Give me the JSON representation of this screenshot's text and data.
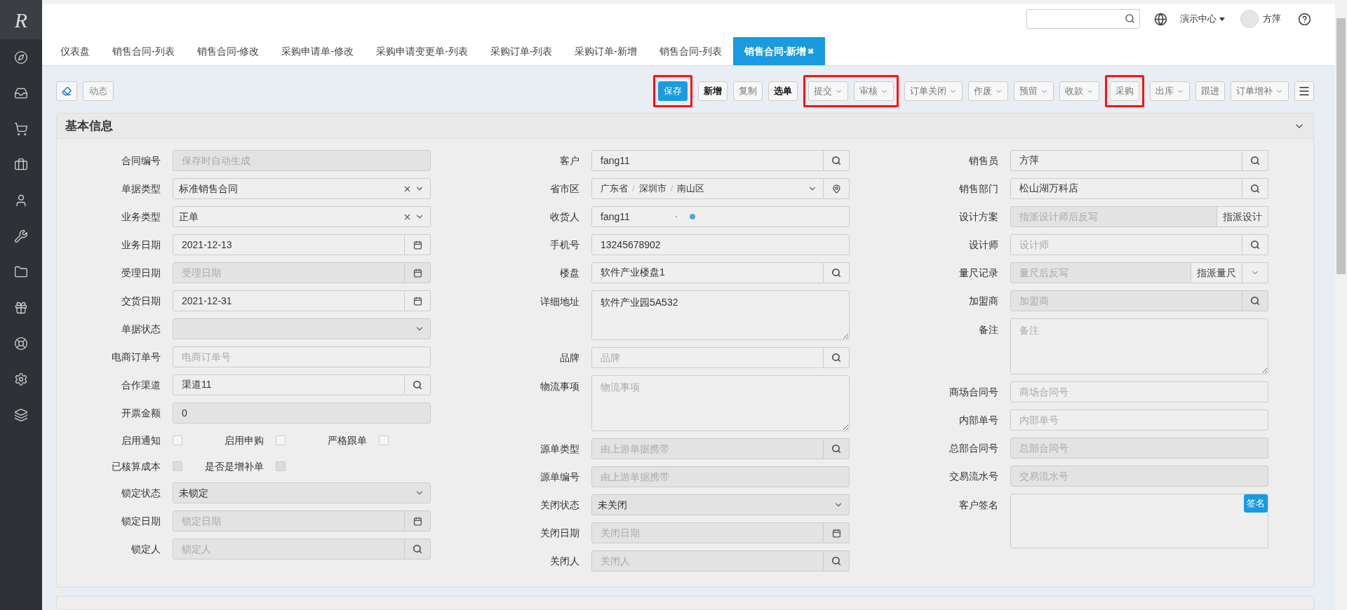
{
  "sidebar": {
    "logo": "R"
  },
  "top_bar": {
    "org_menu": "演示中心",
    "user_name": "方萍"
  },
  "tabs": [
    {
      "label": "仪表盘",
      "selected": false
    },
    {
      "label": "销售合同-列表",
      "selected": false
    },
    {
      "label": "销售合同-修改",
      "selected": false
    },
    {
      "label": "采购申请单-修改",
      "selected": false
    },
    {
      "label": "采购申请变更单-列表",
      "selected": false
    },
    {
      "label": "采购订单-列表",
      "selected": false
    },
    {
      "label": "采购订单-新增",
      "selected": false
    },
    {
      "label": "销售合同-列表",
      "selected": false
    },
    {
      "label": "销售合同-新增",
      "selected": true,
      "close": "✖"
    }
  ],
  "toolbar": {
    "left_buttons": [
      {
        "label": "动态",
        "disabled": true
      }
    ],
    "groups": [
      {
        "highlighted": true,
        "buttons": [
          {
            "label": "保存",
            "primary": true,
            "disabled": false,
            "dropdown": false
          }
        ]
      },
      {
        "highlighted": false,
        "buttons": [
          {
            "label": "新增",
            "primary": false,
            "disabled": false,
            "dropdown": false
          },
          {
            "label": "复制",
            "primary": false,
            "disabled": true,
            "dropdown": false
          },
          {
            "label": "选单",
            "primary": false,
            "disabled": false,
            "dropdown": false
          }
        ]
      },
      {
        "highlighted": true,
        "buttons": [
          {
            "label": "提交",
            "primary": false,
            "disabled": true,
            "dropdown": true
          },
          {
            "label": "审核",
            "primary": false,
            "disabled": true,
            "dropdown": true
          }
        ]
      },
      {
        "highlighted": false,
        "buttons": [
          {
            "label": "订单关闭",
            "primary": false,
            "disabled": true,
            "dropdown": true
          },
          {
            "label": "作废",
            "primary": false,
            "disabled": true,
            "dropdown": true
          },
          {
            "label": "预留",
            "primary": false,
            "disabled": true,
            "dropdown": true
          },
          {
            "label": "收款",
            "primary": false,
            "disabled": true,
            "dropdown": true
          }
        ]
      },
      {
        "highlighted": true,
        "buttons": [
          {
            "label": "采购",
            "primary": false,
            "disabled": true,
            "dropdown": false
          }
        ]
      },
      {
        "highlighted": false,
        "buttons": [
          {
            "label": "出库",
            "primary": false,
            "disabled": true,
            "dropdown": true
          },
          {
            "label": "跟进",
            "primary": false,
            "disabled": true,
            "dropdown": false
          },
          {
            "label": "订单增补",
            "primary": false,
            "disabled": true,
            "dropdown": true
          }
        ]
      }
    ]
  },
  "panel": {
    "title": "基本信息",
    "expanded": true,
    "columns": [
      [
        {
          "kind": "input",
          "label": "合同编号",
          "placeholder": "保存时自动生成",
          "disabled": true
        },
        {
          "kind": "select",
          "label": "单据类型",
          "value": "标准销售合同",
          "clearable": true,
          "disabled": false
        },
        {
          "kind": "select",
          "label": "业务类型",
          "value": "正单",
          "clearable": true,
          "disabled": false
        },
        {
          "kind": "input",
          "label": "业务日期",
          "value": "2021-12-13",
          "disabled": false,
          "calendar": true
        },
        {
          "kind": "input",
          "label": "受理日期",
          "placeholder": "受理日期",
          "disabled": true,
          "calendar": true
        },
        {
          "kind": "input",
          "label": "交货日期",
          "value": "2021-12-31",
          "disabled": false,
          "calendar": true
        },
        {
          "kind": "select",
          "label": "单据状态",
          "clearable": false,
          "disabled": true
        },
        {
          "kind": "input",
          "label": "电商订单号",
          "placeholder": "电商订单号",
          "disabled": false
        },
        {
          "kind": "input",
          "label": "合作渠道",
          "value": "渠道11",
          "disabled": false,
          "search": true
        },
        {
          "kind": "input",
          "label": "开票金额",
          "value": "0",
          "disabled": true
        },
        {
          "kind": "checks",
          "items": [
            {
              "label": "启用通知",
              "checked": false,
              "disabled": false
            },
            {
              "label": "启用申购",
              "checked": false,
              "disabled": false
            },
            {
              "label": "严格跟单",
              "checked": false,
              "disabled": false
            }
          ]
        },
        {
          "kind": "checks",
          "items": [
            {
              "label": "已核算成本",
              "checked": false,
              "disabled": true
            },
            {
              "label": "是否是增补单",
              "checked": false,
              "disabled": true
            }
          ]
        },
        {
          "kind": "select",
          "label": "锁定状态",
          "value": "未锁定",
          "clearable": false,
          "disabled": true
        },
        {
          "kind": "input",
          "label": "锁定日期",
          "placeholder": "锁定日期",
          "disabled": true,
          "calendar": true
        },
        {
          "kind": "input",
          "label": "锁定人",
          "placeholder": "锁定人",
          "disabled": true,
          "search": true
        }
      ],
      [
        {
          "kind": "input",
          "label": "客户",
          "value": "fang11",
          "disabled": false,
          "search": true
        },
        {
          "kind": "cascader",
          "label": "省市区",
          "segments": [
            "广东省",
            "/",
            "深圳市",
            "/",
            "南山区"
          ],
          "pin": true
        },
        {
          "kind": "input",
          "label": "收货人",
          "value": "fang11",
          "disabled": false,
          "busy": true
        },
        {
          "kind": "input",
          "label": "手机号",
          "value": "13245678902",
          "disabled": false
        },
        {
          "kind": "input",
          "label": "楼盘",
          "value": "软件产业楼盘1",
          "disabled": false,
          "search": true
        },
        {
          "kind": "textarea",
          "label": "详细地址",
          "value": "软件产业园5A532",
          "tall": false
        },
        {
          "kind": "input",
          "label": "品牌",
          "placeholder": "品牌",
          "disabled": false,
          "search": true
        },
        {
          "kind": "textarea",
          "label": "物流事项",
          "placeholder": "物流事项",
          "tall": true
        },
        {
          "kind": "input",
          "label": "源单类型",
          "placeholder": "由上游单据携带",
          "disabled": true,
          "search": true
        },
        {
          "kind": "input",
          "label": "源单编号",
          "placeholder": "由上游单据携带",
          "disabled": true
        },
        {
          "kind": "select",
          "label": "关闭状态",
          "value": "未关闭",
          "clearable": false,
          "disabled": true
        },
        {
          "kind": "input",
          "label": "关闭日期",
          "placeholder": "关闭日期",
          "disabled": true,
          "calendar": true
        },
        {
          "kind": "input",
          "label": "关闭人",
          "placeholder": "关闭人",
          "disabled": true,
          "search": true
        }
      ],
      [
        {
          "kind": "input",
          "label": "销售员",
          "value": "方萍",
          "disabled": false,
          "search": true
        },
        {
          "kind": "input",
          "label": "销售部门",
          "value": "松山湖万科店",
          "disabled": false,
          "search": true
        },
        {
          "kind": "input",
          "label": "设计方案",
          "placeholder": "指派设计师后反写",
          "disabled": true,
          "addon_text": "指派设计"
        },
        {
          "kind": "input",
          "label": "设计师",
          "placeholder": "设计师",
          "disabled": false,
          "search": true
        },
        {
          "kind": "input",
          "label": "量尺记录",
          "placeholder": "量尺后反写",
          "disabled": true,
          "addon_text": "指派量尺",
          "chevron": true
        },
        {
          "kind": "input",
          "label": "加盟商",
          "placeholder": "加盟商",
          "disabled": true,
          "search": true
        },
        {
          "kind": "textarea",
          "label": "备注",
          "placeholder": "备注",
          "tall": true
        },
        {
          "kind": "input",
          "label": "商场合同号",
          "placeholder": "商场合同号",
          "disabled": false
        },
        {
          "kind": "input",
          "label": "内部单号",
          "placeholder": "内部单号",
          "disabled": false
        },
        {
          "kind": "input",
          "label": "总部合同号",
          "placeholder": "总部合同号",
          "disabled": true
        },
        {
          "kind": "input",
          "label": "交易流水号",
          "placeholder": "交易流水号",
          "disabled": true
        },
        {
          "kind": "signature",
          "label": "客户签名",
          "button": "签名"
        }
      ]
    ]
  }
}
